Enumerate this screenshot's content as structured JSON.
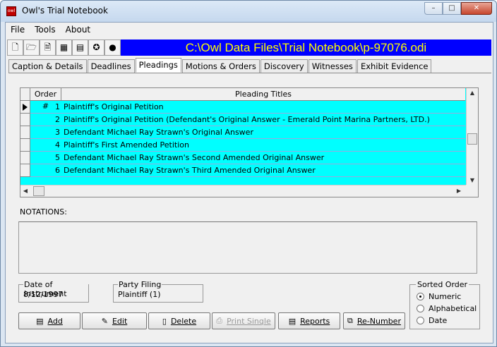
{
  "window": {
    "title": "Owl's Trial Notebook",
    "app_icon_text": "owl"
  },
  "menu": [
    "File",
    "Tools",
    "About"
  ],
  "toolbar": {
    "icons": [
      "new-file-icon",
      "open-folder-icon",
      "document-icon",
      "calendar-icon",
      "calculator-icon",
      "wizard-icon",
      "globe-icon"
    ],
    "path": "C:\\Owl Data Files\\Trial Notebook\\p-97076.odi"
  },
  "tabs": [
    "Caption & Details",
    "Deadlines",
    "Pleadings",
    "Motions & Orders",
    "Discovery",
    "Witnesses",
    "Exhibit Evidence"
  ],
  "active_tab": "Pleadings",
  "grid": {
    "headers": {
      "order": "Order #",
      "title": "Pleading Titles"
    },
    "rows": [
      {
        "order": "1",
        "title": "Plaintiff's Original Petition"
      },
      {
        "order": "2",
        "title": "Plaintiff's Original Petition (Defendant's Original Answer - Emerald Point Marina Partners, LTD.)"
      },
      {
        "order": "3",
        "title": "Defendant Michael Ray Strawn's Original Answer"
      },
      {
        "order": "4",
        "title": "Plaintiff's First Amended Petition"
      },
      {
        "order": "5",
        "title": "Defendant Michael Ray Strawn's Second Amended Original Answer"
      },
      {
        "order": "6",
        "title": "Defendant Michael Ray Strawn's Third Amended Original Answer"
      }
    ]
  },
  "notations_label": "NOTATIONS:",
  "date_of_instrument": {
    "label": "Date of Instrument",
    "value": "8/12/1997"
  },
  "party_filing": {
    "label": "Party Filing",
    "value": "Plaintiff (1)"
  },
  "sorted_order": {
    "label": "Sorted Order",
    "options": [
      "Numeric",
      "Alphabetical",
      "Date"
    ],
    "selected": "Numeric"
  },
  "buttons": {
    "add": "Add",
    "edit": "Edit",
    "delete": "Delete",
    "print_single": "Print Single",
    "reports": "Reports",
    "renumber": "Re-Number"
  },
  "colors": {
    "grid_bg": "#00ffff",
    "path_bg": "#0000ff",
    "path_fg": "#ffff00"
  }
}
